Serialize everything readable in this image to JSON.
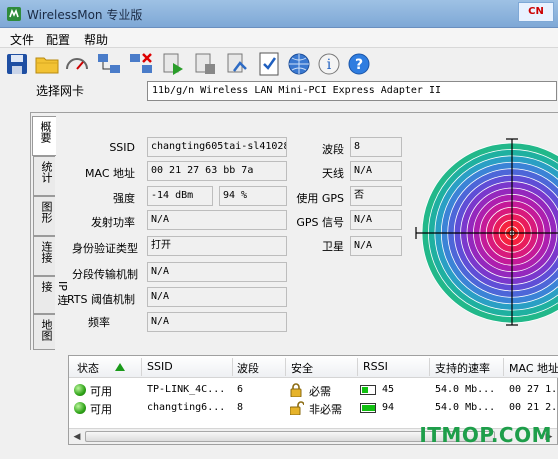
{
  "window": {
    "title": "WirelessMon 专业版"
  },
  "menu": [
    {
      "label": "文件"
    },
    {
      "label": "配置"
    },
    {
      "label": "帮助"
    }
  ],
  "toolbar": {
    "buttons": [
      {
        "icon": "save-icon"
      },
      {
        "icon": "open-folder-icon"
      },
      {
        "icon": "gauge-icon"
      },
      {
        "icon": "network-connect-icon"
      },
      {
        "icon": "network-disconnect-icon"
      },
      {
        "icon": "play-log-icon"
      },
      {
        "icon": "stop-log-icon"
      },
      {
        "icon": "settings-icon"
      },
      {
        "icon": "checklist-icon"
      },
      {
        "icon": "globe-icon"
      },
      {
        "icon": "info-icon"
      },
      {
        "icon": "help-icon"
      }
    ]
  },
  "adapter": {
    "label": "选择网卡",
    "value": "11b/g/n  Wireless LAN Mini-PCI Express Adapter II"
  },
  "side_tabs": [
    {
      "label": "概要"
    },
    {
      "label": "统计"
    },
    {
      "label": "图形"
    },
    {
      "label": "连接"
    },
    {
      "label": "IP 连接"
    },
    {
      "label": "地图"
    }
  ],
  "summary": {
    "ssid": {
      "label": "SSID",
      "value": "changting605tai-sl41028"
    },
    "mac": {
      "label": "MAC 地址",
      "value": "00 21 27 63 bb 7a"
    },
    "strength": {
      "label": "强度",
      "dbm": "-14 dBm",
      "percent": "94 %"
    },
    "tx_power": {
      "label": "发射功率",
      "value": "N/A"
    },
    "auth": {
      "label": "身份验证类型",
      "value": "打开"
    },
    "frag": {
      "label": "分段传输机制",
      "value": "N/A"
    },
    "rts": {
      "label": "RTS 阈值机制",
      "value": "N/A"
    },
    "freq": {
      "label": "频率",
      "value": "N/A"
    },
    "channel": {
      "label": "波段",
      "value": "8"
    },
    "antenna": {
      "label": "天线",
      "value": "N/A"
    },
    "use_gps": {
      "label": "使用 GPS",
      "value": "否"
    },
    "gps_signal": {
      "label": "GPS 信号",
      "value": "N/A"
    },
    "satellite": {
      "label": "卫星",
      "value": "N/A"
    }
  },
  "table": {
    "columns": [
      "状态",
      "SSID",
      "波段",
      "安全",
      "RSSI",
      "支持的速率",
      "MAC 地址"
    ],
    "rows": [
      {
        "status": "可用",
        "ssid": "TP-LINK_4C...",
        "channel": "6",
        "security": "必需",
        "rssi": "45",
        "rssi_level": 0.45,
        "rate": "54.0 Mb...",
        "mac": "00 27 1..."
      },
      {
        "status": "可用",
        "ssid": "changting6...",
        "channel": "8",
        "security": "非必需",
        "rssi": "94",
        "rssi_level": 0.94,
        "rate": "54.0 Mb...",
        "mac": "00 21 2..."
      }
    ]
  },
  "watermark": "ITMOP.COM",
  "colors": {
    "radar_center": "#ff2a2a",
    "radar_outer": "#22b88a",
    "rssi_fill": "#10c010"
  }
}
